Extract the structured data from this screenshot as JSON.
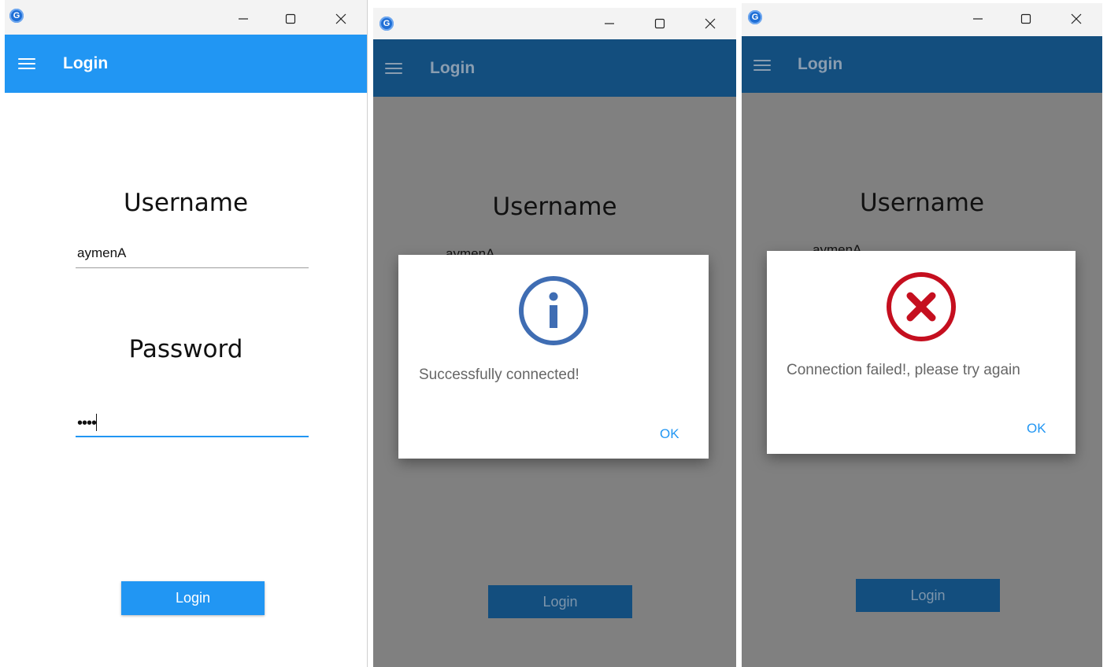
{
  "windows": [
    {
      "title": "Login",
      "app_icon_letter": "G",
      "controls": {
        "minimize": "—",
        "maximize": "☐",
        "close": "✕"
      },
      "username_label": "Username",
      "username_value": "aymenA",
      "password_label": "Password",
      "password_value": "••••",
      "login_button": "Login"
    },
    {
      "title": "Login",
      "app_icon_letter": "G",
      "controls": {
        "minimize": "—",
        "maximize": "☐",
        "close": "✕"
      },
      "username_label": "Username",
      "username_value": "aymenA",
      "login_button": "Login",
      "dialog": {
        "icon": "info-icon",
        "message": "Successfully connected!",
        "ok": "OK",
        "icon_color": "#3f6db3"
      }
    },
    {
      "title": "Login",
      "app_icon_letter": "G",
      "controls": {
        "minimize": "—",
        "maximize": "☐",
        "close": "✕"
      },
      "username_label": "Username",
      "username_value": "aymenA",
      "login_button": "Login",
      "dialog": {
        "icon": "error-icon",
        "message": "Connection failed!, please try again",
        "ok": "OK",
        "icon_color": "#c50f1f"
      }
    }
  ],
  "colors": {
    "appbar_active": "#2196f3",
    "appbar_dimmed": "#134e7e",
    "overlay": "#808080",
    "button_active": "#2196f3",
    "button_dimmed": "#134e7e",
    "ok_text": "#2196f3"
  }
}
